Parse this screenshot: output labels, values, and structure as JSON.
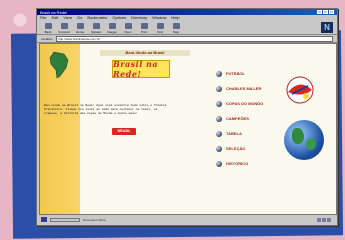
{
  "window": {
    "title": "Brasil na Rede!"
  },
  "menubar": [
    "File",
    "Edit",
    "View",
    "Go",
    "Bookmarks",
    "Options",
    "Directory",
    "Window",
    "Help"
  ],
  "toolbar": [
    {
      "label": "Back",
      "icon": "back-icon"
    },
    {
      "label": "Forward",
      "icon": "forward-icon"
    },
    {
      "label": "Home",
      "icon": "home-icon"
    },
    {
      "label": "Reload",
      "icon": "reload-icon"
    },
    {
      "label": "Images",
      "icon": "images-icon"
    },
    {
      "label": "Open",
      "icon": "open-icon"
    },
    {
      "label": "Print",
      "icon": "print-icon"
    },
    {
      "label": "Find",
      "icon": "find-icon"
    },
    {
      "label": "Stop",
      "icon": "stop-icon"
    }
  ],
  "location": {
    "label": "Location:",
    "url": "http://www.brasilnarede.com.br/"
  },
  "page": {
    "header": "Bem-Vindo ao Brasil",
    "banner": "Brasil na Rede!",
    "intro": "Bem-vindo ao Brasil na Rede! Aqui você encontra tudo sobre o futebol brasileiro. Clique nos links ao lado para conhecer os times, os craques, a história das Copas do Mundo e muito mais!",
    "logo": "BRASIL",
    "menu": [
      "FUTEBOL",
      "CHARLES MILLER",
      "COPAS DO MUNDO",
      "CAMPEÕES",
      "TABELA",
      "SELEÇÃO",
      "HISTÓRICO"
    ]
  },
  "status": {
    "text": "Document: Done"
  }
}
